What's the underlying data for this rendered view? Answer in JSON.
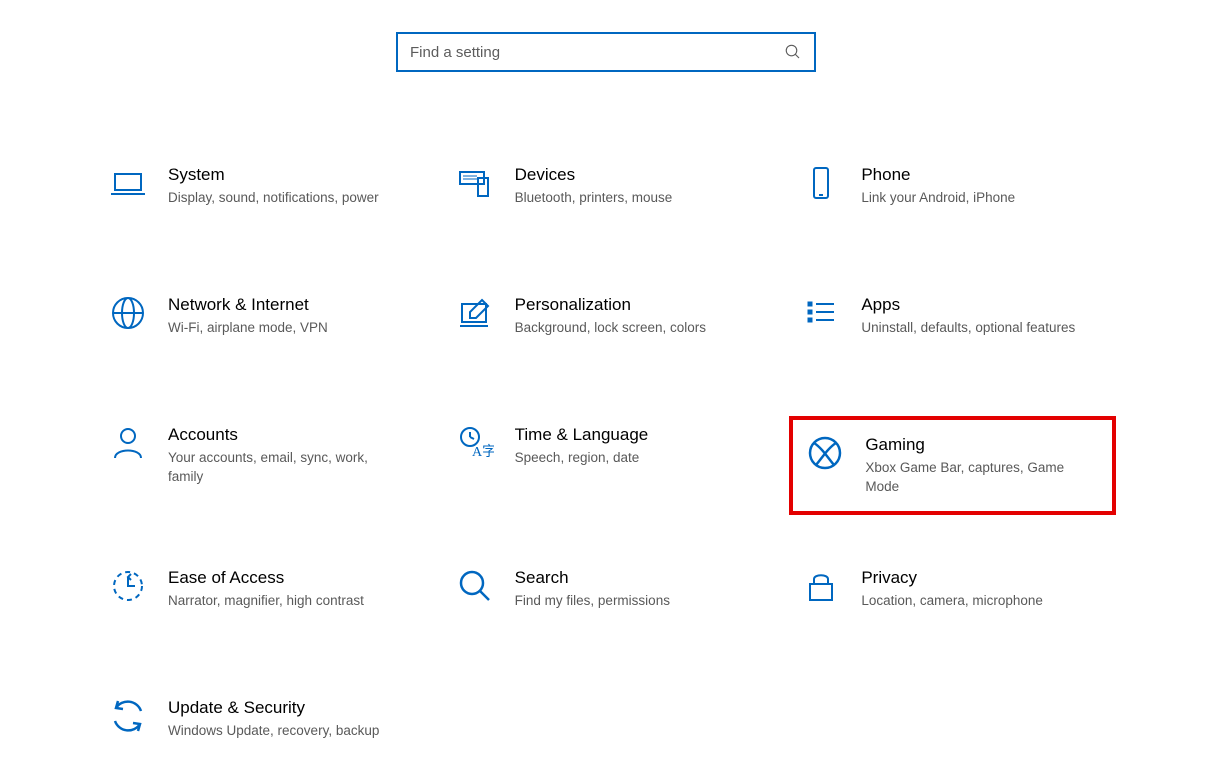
{
  "search": {
    "placeholder": "Find a setting"
  },
  "tiles": [
    {
      "id": "system",
      "icon": "laptop-icon",
      "title": "System",
      "desc": "Display, sound, notifications, power"
    },
    {
      "id": "devices",
      "icon": "devices-icon",
      "title": "Devices",
      "desc": "Bluetooth, printers, mouse"
    },
    {
      "id": "phone",
      "icon": "phone-icon",
      "title": "Phone",
      "desc": "Link your Android, iPhone"
    },
    {
      "id": "network",
      "icon": "globe-icon",
      "title": "Network & Internet",
      "desc": "Wi-Fi, airplane mode, VPN"
    },
    {
      "id": "personalization",
      "icon": "personalize-icon",
      "title": "Personalization",
      "desc": "Background, lock screen, colors"
    },
    {
      "id": "apps",
      "icon": "apps-icon",
      "title": "Apps",
      "desc": "Uninstall, defaults, optional features"
    },
    {
      "id": "accounts",
      "icon": "person-icon",
      "title": "Accounts",
      "desc": "Your accounts, email, sync, work, family"
    },
    {
      "id": "time-language",
      "icon": "time-language-icon",
      "title": "Time & Language",
      "desc": "Speech, region, date"
    },
    {
      "id": "gaming",
      "icon": "xbox-icon",
      "title": "Gaming",
      "desc": "Xbox Game Bar, captures, Game Mode",
      "highlight": true
    },
    {
      "id": "ease-of-access",
      "icon": "ease-icon",
      "title": "Ease of Access",
      "desc": "Narrator, magnifier, high contrast"
    },
    {
      "id": "search",
      "icon": "magnifier-icon",
      "title": "Search",
      "desc": "Find my files, permissions"
    },
    {
      "id": "privacy",
      "icon": "lock-icon",
      "title": "Privacy",
      "desc": "Location, camera, microphone"
    },
    {
      "id": "update-security",
      "icon": "update-icon",
      "title": "Update & Security",
      "desc": "Windows Update, recovery, backup"
    }
  ],
  "colors": {
    "accent": "#0067c0",
    "highlight": "#e30000"
  }
}
